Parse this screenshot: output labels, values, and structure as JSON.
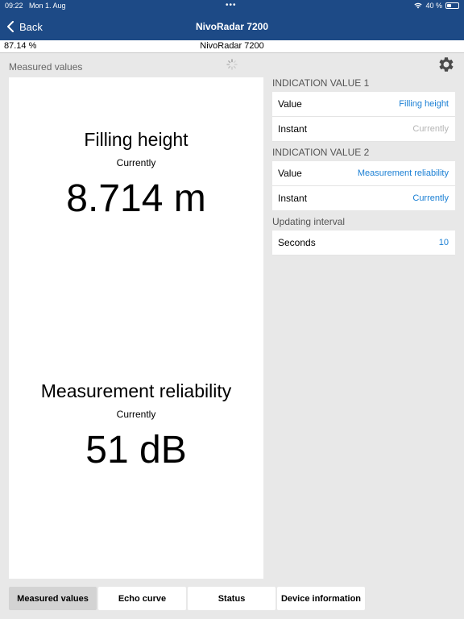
{
  "status_bar": {
    "time": "09:22",
    "date": "Mon 1. Aug",
    "dots": "•••",
    "wifi_icon": "wifi-icon",
    "battery": "40 %",
    "battery_level": 0.4
  },
  "nav": {
    "back_label": "Back",
    "title": "NivoRadar 7200"
  },
  "subheader": {
    "left": "87.14 %",
    "center": "NivoRadar 7200"
  },
  "section_label": "Measured values",
  "measurements": [
    {
      "title": "Filling height",
      "subtitle": "Currently",
      "value": "8.714 m"
    },
    {
      "title": "Measurement reliability",
      "subtitle": "Currently",
      "value": "51 dB"
    }
  ],
  "settings": {
    "group1": {
      "title": "INDICATION VALUE 1",
      "rows": [
        {
          "label": "Value",
          "value": "Filling height"
        },
        {
          "label": "Instant",
          "value": "Currently"
        }
      ]
    },
    "group2": {
      "title": "INDICATION VALUE 2",
      "rows": [
        {
          "label": "Value",
          "value": "Measurement reliability"
        },
        {
          "label": "Instant",
          "value": "Currently"
        }
      ]
    },
    "group3": {
      "title": "Updating interval",
      "rows": [
        {
          "label": "Seconds",
          "value": "10"
        }
      ]
    }
  },
  "tabs": [
    {
      "label": "Measured values",
      "active": true
    },
    {
      "label": "Echo curve",
      "active": false
    },
    {
      "label": "Status",
      "active": false
    },
    {
      "label": "Device information",
      "active": false
    }
  ],
  "colors": {
    "nav_bg": "#1d4a86",
    "link": "#1a7fd4",
    "muted": "#b5b5b5"
  }
}
